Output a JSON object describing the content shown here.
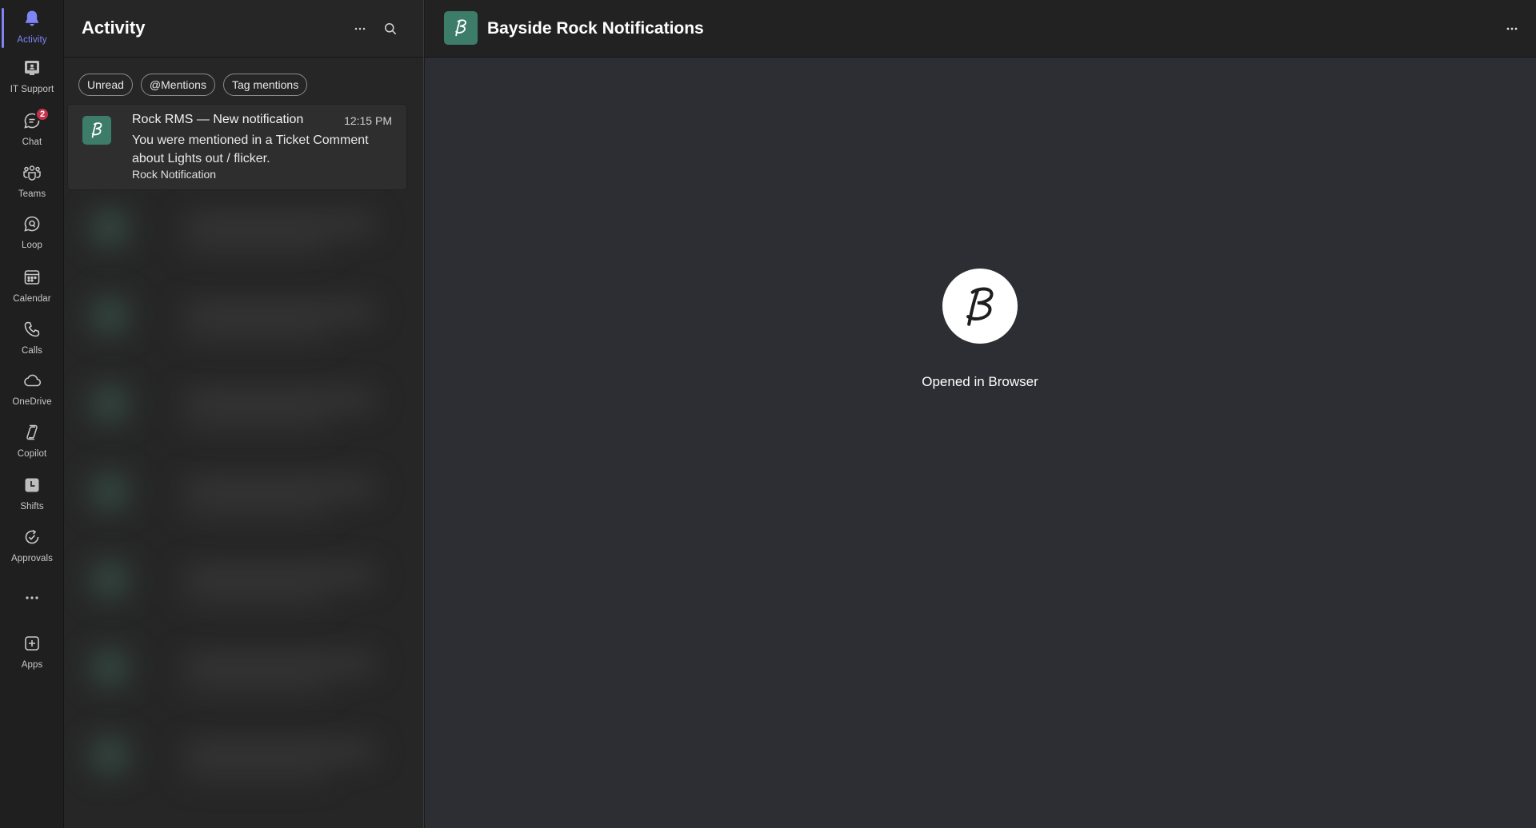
{
  "rail": {
    "items": [
      {
        "label": "Activity",
        "icon": "bell-icon",
        "active": true
      },
      {
        "label": "IT Support",
        "icon": "it-support-icon"
      },
      {
        "label": "Chat",
        "icon": "chat-icon",
        "badge": "2"
      },
      {
        "label": "Teams",
        "icon": "teams-icon"
      },
      {
        "label": "Loop",
        "icon": "loop-icon"
      },
      {
        "label": "Calendar",
        "icon": "calendar-icon"
      },
      {
        "label": "Calls",
        "icon": "phone-icon"
      },
      {
        "label": "OneDrive",
        "icon": "cloud-icon"
      },
      {
        "label": "Copilot",
        "icon": "copilot-icon"
      },
      {
        "label": "Shifts",
        "icon": "shifts-icon"
      },
      {
        "label": "Approvals",
        "icon": "approvals-icon"
      },
      {
        "label": "Apps",
        "icon": "add-app-icon"
      }
    ],
    "accent": "#7f85f5",
    "badge_color": "#c4314b"
  },
  "activity": {
    "title": "Activity",
    "filters": [
      "Unread",
      "@Mentions",
      "Tag mentions"
    ],
    "notification": {
      "title": "Rock RMS — New notification",
      "time": "12:15 PM",
      "body": "You were mentioned in a Ticket Comment about Lights out / flicker.",
      "subtitle": "Rock Notification"
    }
  },
  "main": {
    "title": "Bayside Rock Notifications",
    "status_text": "Opened in Browser",
    "brand_color": "#3d7c69"
  }
}
